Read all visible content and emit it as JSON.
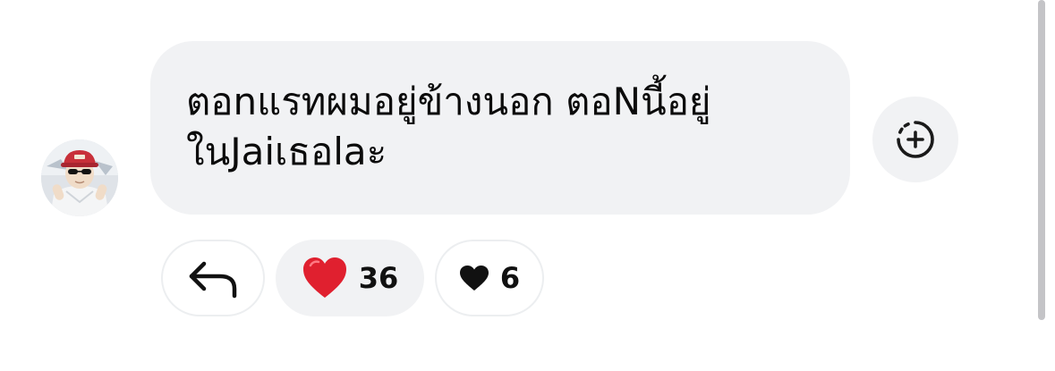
{
  "comment": {
    "text": "ตอnแรทผมอยู่ข้างนอก ตอNนี้อยู่\nในJaiเธอlaะ"
  },
  "reactions": {
    "heart_count": "36",
    "like_count": "6"
  },
  "icons": {
    "reply": "reply-arrow-icon",
    "heart_emoji": "red-heart-emoji-icon",
    "like": "small-heart-icon",
    "add_reaction": "add-reaction-dashed-circle-icon"
  },
  "colors": {
    "bubble_background": "#f1f2f4",
    "heart_red": "#e0202f",
    "text": "#0b0b0b",
    "cap_red": "#c8303a"
  }
}
